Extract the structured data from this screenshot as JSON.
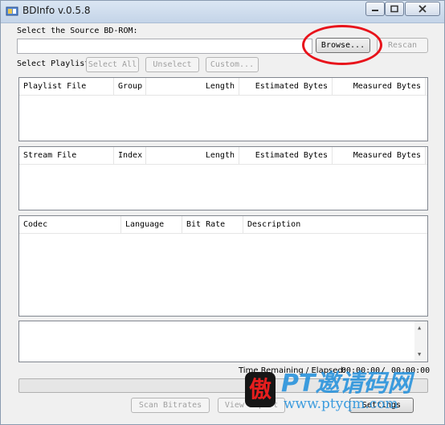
{
  "window": {
    "title": "BDInfo v.0.5.8",
    "controls": {
      "minimize_icon": "minimize-icon",
      "maximize_icon": "maximize-icon",
      "close_icon": "close-icon"
    }
  },
  "source": {
    "label": "Select the Source BD-ROM:",
    "path_value": "",
    "browse_label": "Browse...",
    "rescan_label": "Rescan"
  },
  "playlist_selector": {
    "label": "Select Playlist",
    "select_all_label": "Select All",
    "unselect_label": "Unselect",
    "custom_label": "Custom..."
  },
  "playlist_table": {
    "columns": [
      "Playlist File",
      "Group",
      "Length",
      "Estimated Bytes",
      "Measured Bytes"
    ]
  },
  "stream_table": {
    "columns": [
      "Stream File",
      "Index",
      "Length",
      "Estimated Bytes",
      "Measured Bytes"
    ]
  },
  "codec_table": {
    "columns": [
      "Codec",
      "Language",
      "Bit Rate",
      "Description"
    ]
  },
  "status": {
    "time_label": "Time Remaining / Elapsed:",
    "time_remaining": "00:00:00",
    "separator": "/",
    "time_elapsed": "00:00:00",
    "progress": 0
  },
  "actions": {
    "scan_bitrates_label": "Scan Bitrates",
    "view_report_label": "View Report",
    "settings_label": "Settings"
  },
  "watermark": {
    "seal_char": "傲",
    "text": "PT邀请码网",
    "url": "www.ptyqm.com"
  },
  "colors": {
    "highlight_circle": "#e8131b",
    "watermark_blue": "#1e8edc",
    "progress_green": "#06b025"
  }
}
